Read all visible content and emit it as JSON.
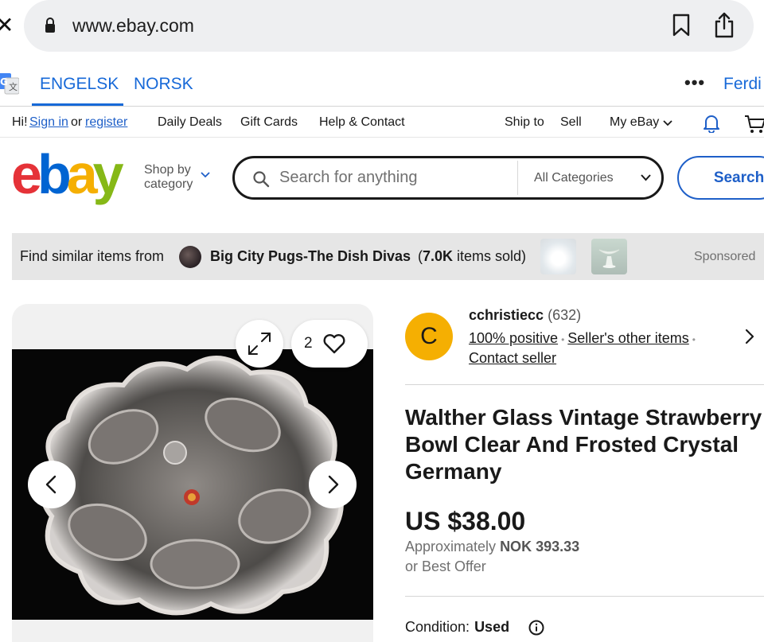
{
  "browser": {
    "url": "www.ebay.com"
  },
  "translate": {
    "active_language": "ENGELSK",
    "other_language": "NORSK",
    "more": "•••",
    "right_label": "Ferdi"
  },
  "topnav": {
    "greeting": "Hi!",
    "sign_in": "Sign in",
    "or": "or",
    "register": "register",
    "daily_deals": "Daily Deals",
    "gift_cards": "Gift Cards",
    "help_contact": "Help & Contact",
    "ship_to": "Ship to",
    "sell": "Sell",
    "my_ebay": "My eBay"
  },
  "header": {
    "logo_letters": [
      "e",
      "b",
      "a",
      "y"
    ],
    "shop_by_line1": "Shop by",
    "shop_by_line2": "category",
    "search_placeholder": "Search for anything",
    "category_select": "All Categories",
    "search_button": "Search"
  },
  "banner": {
    "prefix": "Find similar items from",
    "store_name": "Big City Pugs-The Dish Divas",
    "sold_open": "(",
    "sold_count": "7.0K",
    "sold_suffix": " items sold)",
    "sponsored": "Sponsored"
  },
  "gallery": {
    "watch_count": "2"
  },
  "seller": {
    "avatar_letter": "C",
    "name": "cchristiecc",
    "score": "(632)",
    "positive": "100% positive",
    "other_items": "Seller's other items",
    "contact": "Contact seller"
  },
  "item": {
    "title": "Walther Glass Vintage Strawberry Bowl Clear And Frosted Crystal Germany",
    "price": "US $38.00",
    "approx_prefix": "Approximately",
    "approx_value": "NOK 393.33",
    "best_offer": "or Best Offer",
    "condition_label": "Condition:",
    "condition_value": "Used"
  },
  "colors": {
    "link_blue": "#1e5fc8",
    "translate_blue": "#1769d8",
    "avatar_yellow": "#f5af02",
    "logo_red": "#e53238",
    "logo_blue": "#0064d2",
    "logo_yellow": "#f5af02",
    "logo_green": "#86b817"
  },
  "icons": {
    "close": "close-icon",
    "lock": "lock-icon",
    "bookmark": "bookmark-icon",
    "share": "share-icon",
    "translate": "translate-icon",
    "bell": "bell-icon",
    "cart": "cart-icon",
    "search": "search-icon",
    "expand": "expand-icon",
    "heart": "heart-icon",
    "prev": "chevron-left-icon",
    "next": "chevron-right-icon",
    "info": "info-icon"
  }
}
